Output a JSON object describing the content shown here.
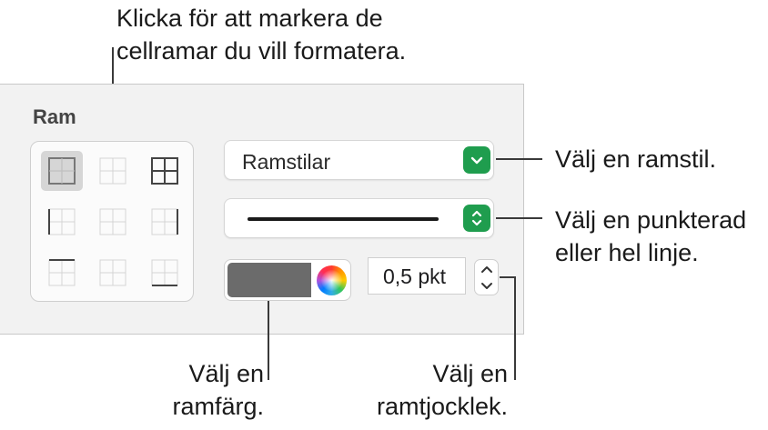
{
  "callouts": {
    "top_line1": "Klicka för att markera de",
    "top_line2": "cellramar du vill formatera.",
    "style_callout": "Välj en ramstil.",
    "line_line1": "Välj en punkterad",
    "line_line2": "eller hel linje.",
    "color_line1": "Välj en",
    "color_line2": "ramfärg.",
    "thickness_line1": "Välj en",
    "thickness_line2": "ramtjocklek."
  },
  "panel": {
    "title": "Ram",
    "border_style_dropdown": {
      "label": "Ramstilar",
      "icon": "chevron-down-icon"
    },
    "line_type_dropdown": {
      "icon": "up-down-chevrons-icon"
    },
    "border_color": {
      "value": "#6b6b6b",
      "icon": "color-wheel-icon"
    },
    "thickness": {
      "value": "0,5 pkt"
    }
  },
  "colors": {
    "accent_green": "#1f9d4e",
    "panel_bg": "#f2f2f2",
    "swatch": "#6b6b6b"
  }
}
